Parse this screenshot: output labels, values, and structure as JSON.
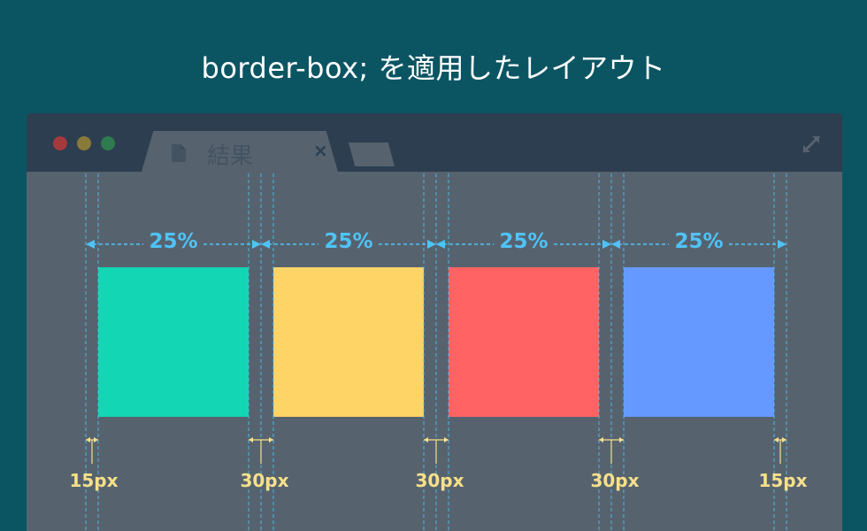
{
  "title": "border-box; を適用したレイアウト",
  "browser": {
    "tab_label": "結果",
    "tab_close": "×",
    "traffic_lights": [
      "#a43a3d",
      "#8a7a3a",
      "#2f7a4f"
    ]
  },
  "columns": [
    {
      "width_label": "25%",
      "color": "#12d6b4"
    },
    {
      "width_label": "25%",
      "color": "#ffd466"
    },
    {
      "width_label": "25%",
      "color": "#ff6363"
    },
    {
      "width_label": "25%",
      "color": "#6699ff"
    }
  ],
  "gaps": [
    "15px",
    "30px",
    "30px",
    "30px",
    "15px"
  ],
  "colors": {
    "background": "#0b5563",
    "window": "#56636f",
    "titlebar": "#2c3e50",
    "percent_annotation": "#4fc3f7",
    "gap_annotation": "#f7e08a"
  }
}
